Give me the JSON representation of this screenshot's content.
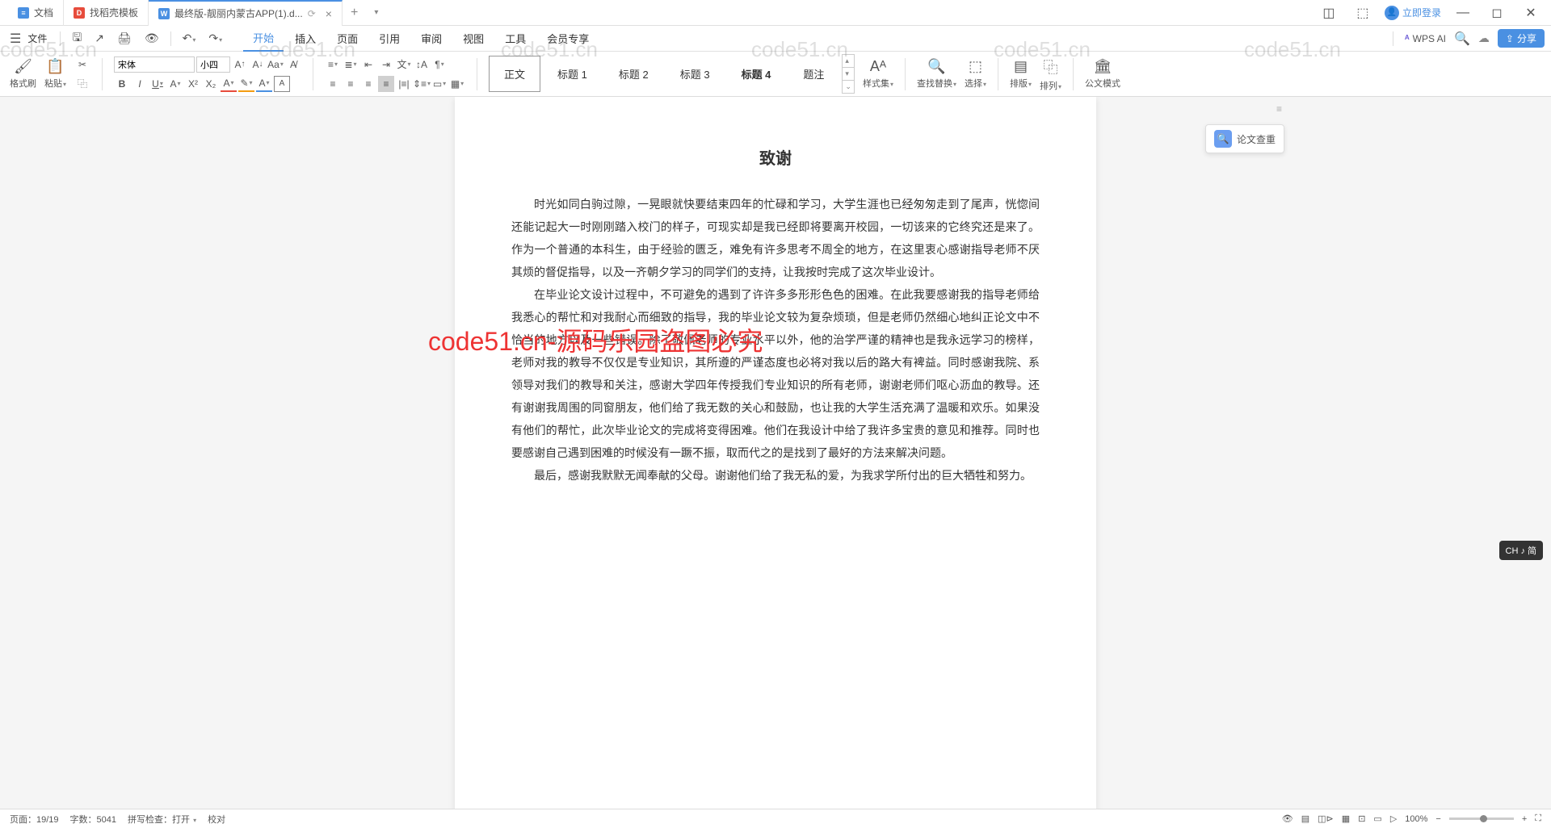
{
  "tabs": {
    "t1": "文档",
    "t2": "找稻壳模板",
    "t3": "最终版-靓丽内蒙古APP(1).d..."
  },
  "login": "立即登录",
  "file_menu": "文件",
  "menus": {
    "start": "开始",
    "insert": "插入",
    "page": "页面",
    "ref": "引用",
    "review": "审阅",
    "view": "视图",
    "tools": "工具",
    "member": "会员专享"
  },
  "wps_ai": "WPS AI",
  "share": "分享",
  "ribbon": {
    "format_painter": "格式刷",
    "paste": "粘贴",
    "font_name": "宋体",
    "font_size": "小四",
    "style_body": "正文",
    "style_h1": "标题 1",
    "style_h2": "标题 2",
    "style_h3": "标题 3",
    "style_h4": "标题 4",
    "style_note": "题注",
    "styles": "样式集",
    "find": "查找替换",
    "select": "选择",
    "layout": "排版",
    "arrange": "排列",
    "official": "公文模式"
  },
  "document": {
    "title": "致谢",
    "p1": "时光如同白驹过隙，一晃眼就快要结束四年的忙碌和学习，大学生涯也已经匆匆走到了尾声，恍惚间还能记起大一时刚刚踏入校门的样子，可现实却是我已经即将要离开校园，一切该来的它终究还是来了。作为一个普通的本科生，由于经验的匮乏，难免有许多思考不周全的地方，在这里衷心感谢指导老师不厌其烦的督促指导，以及一齐朝夕学习的同学们的支持，让我按时完成了这次毕业设计。",
    "p2": "在毕业论文设计过程中，不可避免的遇到了许许多多形形色色的困难。在此我要感谢我的指导老师给我悉心的帮忙和对我耐心而细致的指导，我的毕业论文较为复杂烦琐，但是老师仍然细心地纠正论文中不恰当的地方以及一些错误。除了敬佩老师的专业水平以外，他的治学严谨的精神也是我永远学习的榜样，老师对我的教导不仅仅是专业知识，其所遵的严谨态度也必将对我以后的路大有裨益。同时感谢我院、系领导对我们的教导和关注，感谢大学四年传授我们专业知识的所有老师，谢谢老师们呕心沥血的教导。还有谢谢我周围的同窗朋友，他们给了我无数的关心和鼓励，也让我的大学生活充满了温暖和欢乐。如果没有他们的帮忙，此次毕业论文的完成将变得困难。他们在我设计中给了我许多宝贵的意见和推荐。同时也要感谢自己遇到困难的时候没有一蹶不振，取而代之的是找到了最好的方法来解决问题。",
    "p3": "最后，感谢我默默无闻奉献的父母。谢谢他们给了我无私的爱，为我求学所付出的巨大牺牲和努力。"
  },
  "float_check": "论文查重",
  "watermark_text": "code51.cn",
  "watermark_red": "code51.cn-源码乐园盗图必究",
  "ime": "CH ♪ 简",
  "status": {
    "page": "页面：19/19",
    "words": "字数：5041",
    "spell": "拼写检查：打开",
    "proof": "校对",
    "zoom": "100%"
  }
}
